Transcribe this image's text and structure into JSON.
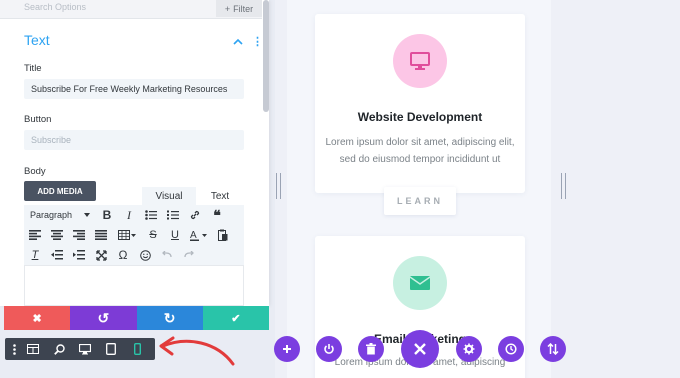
{
  "panel": {
    "search_placeholder": "Search Options",
    "filter_label": "Filter",
    "filter_icon": "+",
    "section_title": "Text",
    "collapse_icon": "^",
    "more_icon": "⋮",
    "title_label": "Title",
    "title_value": "Subscribe For Free Weekly Marketing Resources",
    "button_label": "Button",
    "button_placeholder": "Subscribe",
    "body_label": "Body",
    "add_media": "ADD MEDIA",
    "tabs": {
      "visual": "Visual",
      "text": "Text"
    },
    "paragraph_select": "Paragraph",
    "toolbar_icons_row1": [
      "bold-icon",
      "italic-icon",
      "bulleted-list-icon",
      "numbered-list-icon",
      "link-icon",
      "blockquote-icon"
    ],
    "toolbar_icons_row2": [
      "align-left-icon",
      "align-center-icon",
      "align-right-icon",
      "justify-icon",
      "table-icon",
      "strikethrough-icon",
      "underline-icon",
      "text-color-icon",
      "paste-icon"
    ],
    "toolbar_icons_row3": [
      "clear-format-icon",
      "indent-icon",
      "outdent-icon",
      "fullscreen-icon",
      "special-char-icon",
      "emoji-icon",
      "undo-icon",
      "redo-icon"
    ]
  },
  "actions": {
    "discard_icon": "✖",
    "undo_icon": "↺",
    "redo_icon": "↻",
    "save_icon": "✔"
  },
  "viewbar": {
    "icons": [
      "menu-dots-icon",
      "wireframe-icon",
      "zoom-icon",
      "desktop-view-icon",
      "tablet-view-icon",
      "phone-view-icon"
    ]
  },
  "cards": [
    {
      "title": "Website Development",
      "text": "Lorem ipsum dolor sit amet, adipiscing elit, sed do eiusmod tempor incididunt ut",
      "icon": "monitor-icon",
      "button": "LEARN"
    },
    {
      "title": "Email Marketing",
      "text": "Lorem ipsum dolor sit amet, adipiscing",
      "icon": "envelope-icon"
    }
  ],
  "builder_bar": {
    "icons": [
      "add-icon",
      "power-icon",
      "trash-icon",
      "close-icon",
      "settings-icon",
      "history-icon",
      "portability-icon"
    ]
  },
  "colors": {
    "accent_blue": "#2ea3f2",
    "purple": "#7b3ee0",
    "discard_red": "#ef5a5a",
    "save_teal": "#29c4a9",
    "arrow_red": "#e23b3b"
  }
}
